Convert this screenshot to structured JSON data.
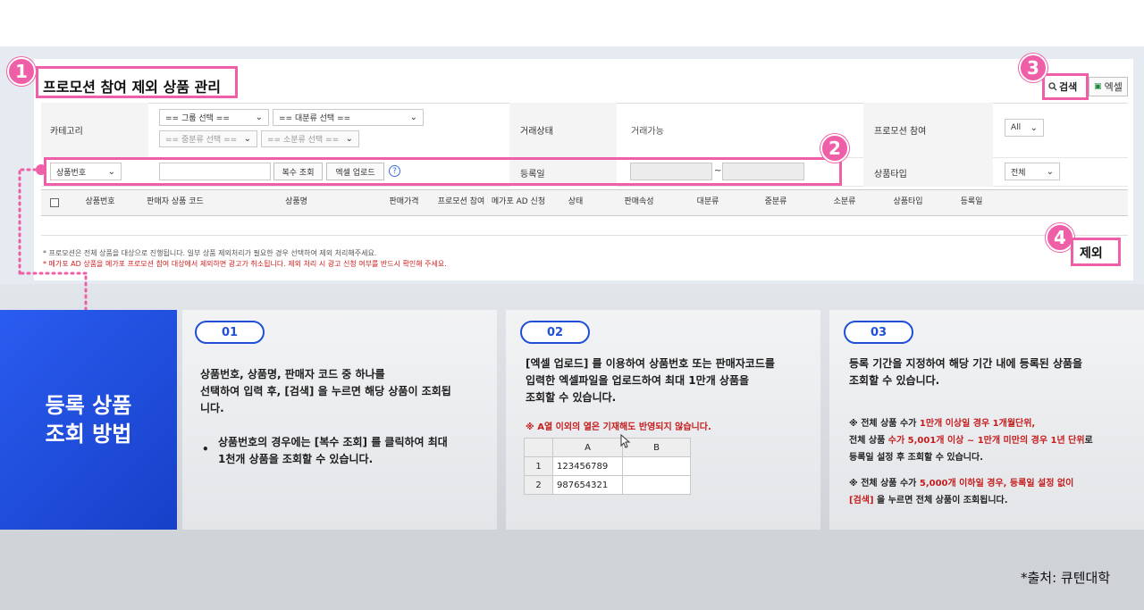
{
  "page": {
    "title": "프로모션 참여 제외 상품 관리",
    "search_label": "검색",
    "excel_label": "엑셀",
    "exclude_label": "제외"
  },
  "badges": [
    "1",
    "2",
    "3",
    "4"
  ],
  "filters": {
    "category_label": "카테고리",
    "group_select": "== 그룹 선택 ==",
    "major_select": "== 대분류 선택 ==",
    "mid_select": "== 중분류 선택 ==",
    "minor_select": "== 소분류 선택 ==",
    "trade_status_label": "거래상태",
    "trade_status_value": "거래가능",
    "promo_join_label": "프로모션 참여",
    "promo_join_value": "All",
    "search_type_select": "상품번호",
    "multi_search_label": "복수 조회",
    "excel_upload_label": "엑셀 업로드",
    "help_icon_text": "?",
    "reg_date_label": "등록일",
    "date_sep": "~",
    "product_type_label": "상품타입",
    "product_type_value": "전체"
  },
  "table": {
    "headers": [
      "상품번호",
      "판매자 상품 코드",
      "상품명",
      "판매가격",
      "프로모션 참여",
      "메가포 AD 신청",
      "상태",
      "판매속성",
      "대분류",
      "중분류",
      "소분류",
      "상품타입",
      "등록일"
    ]
  },
  "notes": {
    "note1": "* 프로모션은 전체 상품을 대상으로 진행됩니다. 일부 상품 제외처리가 필요한 경우 선택하여 제외 처리해주세요.",
    "note2": "* 메가포 AD 상품을 메가포 프로모션 참여 대상에서 제외하면 광고가 취소됩니다. 제외 처리 시 광고 신청 여부를 반드시 확인해 주세요."
  },
  "guide": {
    "title_line1": "등록 상품",
    "title_line2": "조회 방법",
    "card1": {
      "num": "01",
      "line1": "상품번호, 상품명, 판매자 코드 중 하나를",
      "line2": "선택하여 입력 후, [검색] 을 누르면 해당 상품이 조회됩",
      "line3": "니다.",
      "bullet1": "상품번호의 경우에는 [복수 조회] 를 클릭하여 최대",
      "bullet2": "1천개 상품을 조회할 수 있습니다."
    },
    "card2": {
      "num": "02",
      "line1": "[엑셀 업로드] 를 이용하여 상품번호 또는 판매자코드를",
      "line2": "입력한 엑셀파일을 업로드하여 최대 1만개 상품을",
      "line3": "조회할 수 있습니다.",
      "warn": "※ A열 이외의 열은 기재해도 반영되지 않습니다.",
      "col_a": "A",
      "col_b": "B",
      "row1_num": "1",
      "row1_val": "123456789",
      "row2_num": "2",
      "row2_val": "987654321"
    },
    "card3": {
      "num": "03",
      "line1": "등록 기간을 지정하여 해당 기간 내에 등록된 상품을",
      "line2": "조회할 수 있습니다.",
      "n1a": "※ 전체 상품 수가 ",
      "n1b": "1만개 이상일 경우 1개월단위,",
      "n2a": "전체 상품 ",
      "n2b": "수가 5,001개 이상 ~ 1만개 미만의 경우 1년 단위",
      "n2c": "로",
      "n3": "등록일 설정 후 조회할 수 있습니다.",
      "n4a": "※ 전체 상품 수가 ",
      "n4b": "5,000개 이하일 경우, 등록일 설정 없이",
      "n5a": "[검색]",
      "n5b": " 을 누르면 전체 상품이 조회됩니다."
    }
  },
  "source": "*출처: 큐텐대학"
}
